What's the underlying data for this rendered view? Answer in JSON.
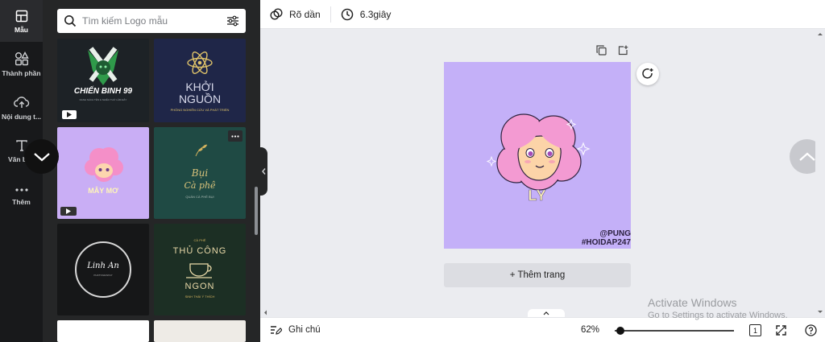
{
  "rail": {
    "items": [
      {
        "label": "Mẫu",
        "icon": "layout-icon"
      },
      {
        "label": "Thành phần",
        "icon": "shapes-icon"
      },
      {
        "label": "Nội dung t...",
        "icon": "cloud-upload-icon"
      },
      {
        "label": "Văn bản",
        "icon": "text-icon"
      },
      {
        "label": "Thêm",
        "icon": "more-icon"
      }
    ]
  },
  "panel": {
    "search": {
      "placeholder": "Tìm kiếm Logo mẫu"
    },
    "templates": {
      "t1": {
        "title": "CHIẾN BINH 99",
        "sub": "DANH SÁCH TÊN & NHIỀU THỨ LẮM ĐÂY"
      },
      "t2": {
        "title1": "KHỞI",
        "title2": "NGUỒN",
        "sub": "PHÒNG NGHIÊN CỨU VÀ PHÁT TRIỂN"
      },
      "t3": {
        "title": "MÂY MƠ"
      },
      "t4": {
        "title1": "Bụi",
        "title2": "Cà phê",
        "sub": "QUÁN CÀ PHÊ BỤI"
      },
      "t5": {
        "title": "Linh An",
        "sub": "PHOTOGRAPHY"
      },
      "t6": {
        "top": "CÀ PHÊ",
        "title1": "THỦ CÔNG",
        "title2": "NGON",
        "sub": "SINH THÁI Ý THÍCH"
      }
    }
  },
  "topbar": {
    "transparency_label": "Rõ dần",
    "timing_label": "6.3giây"
  },
  "canvas": {
    "name_text": "LY",
    "watermark_line1": "@PUNG",
    "watermark_line2": "#HOIDAP247",
    "add_page_label": "+ Thêm trang",
    "page_color": "#c4b0f8"
  },
  "bottombar": {
    "notes_label": "Ghi chú",
    "zoom": "62%",
    "zoom_level": 0.05,
    "page_count": "1"
  },
  "windows": {
    "line1": "Activate Windows",
    "line2": "Go to Settings to activate Windows."
  }
}
